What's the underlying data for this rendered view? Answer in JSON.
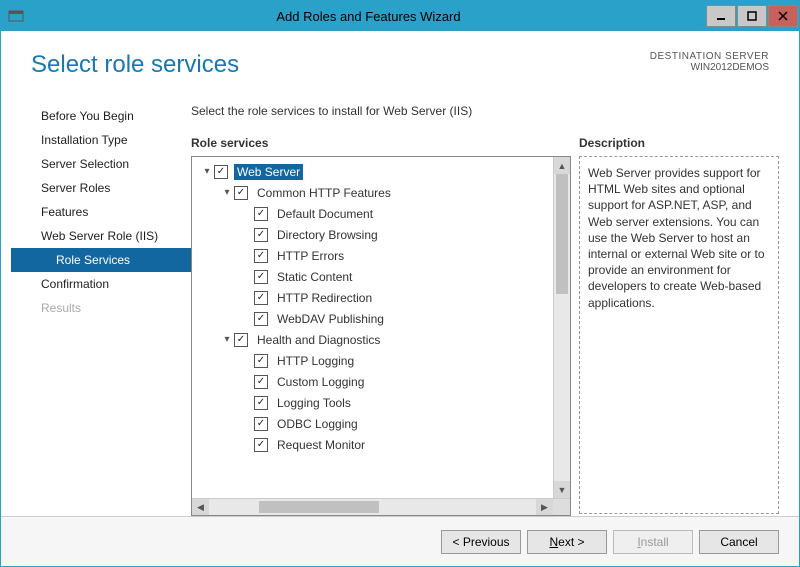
{
  "window": {
    "title": "Add Roles and Features Wizard"
  },
  "header": {
    "title": "Select role services",
    "dest_label": "DESTINATION SERVER",
    "dest_value": "WIN2012DEMOS"
  },
  "nav": {
    "items": [
      {
        "label": "Before You Begin"
      },
      {
        "label": "Installation Type"
      },
      {
        "label": "Server Selection"
      },
      {
        "label": "Server Roles"
      },
      {
        "label": "Features"
      },
      {
        "label": "Web Server Role (IIS)"
      },
      {
        "label": "Role Services",
        "child": true,
        "selected": true
      },
      {
        "label": "Confirmation"
      },
      {
        "label": "Results",
        "disabled": true
      }
    ]
  },
  "content": {
    "instruction": "Select the role services to install for Web Server (IIS)",
    "roles_label": "Role services",
    "desc_label": "Description",
    "desc_text": "Web Server provides support for HTML Web sites and optional support for ASP.NET, ASP, and Web server extensions. You can use the Web Server to host an internal or external Web site or to provide an environment for developers to create Web-based applications."
  },
  "tree": [
    {
      "indent": 0,
      "arrow": "▾",
      "checked": true,
      "label": "Web Server",
      "selected": true
    },
    {
      "indent": 1,
      "arrow": "▾",
      "checked": true,
      "label": "Common HTTP Features"
    },
    {
      "indent": 2,
      "arrow": "",
      "checked": true,
      "label": "Default Document"
    },
    {
      "indent": 2,
      "arrow": "",
      "checked": true,
      "label": "Directory Browsing"
    },
    {
      "indent": 2,
      "arrow": "",
      "checked": true,
      "label": "HTTP Errors"
    },
    {
      "indent": 2,
      "arrow": "",
      "checked": true,
      "label": "Static Content"
    },
    {
      "indent": 2,
      "arrow": "",
      "checked": true,
      "label": "HTTP Redirection"
    },
    {
      "indent": 2,
      "arrow": "",
      "checked": true,
      "label": "WebDAV Publishing"
    },
    {
      "indent": 1,
      "arrow": "▾",
      "checked": true,
      "label": "Health and Diagnostics"
    },
    {
      "indent": 2,
      "arrow": "",
      "checked": true,
      "label": "HTTP Logging"
    },
    {
      "indent": 2,
      "arrow": "",
      "checked": true,
      "label": "Custom Logging"
    },
    {
      "indent": 2,
      "arrow": "",
      "checked": true,
      "label": "Logging Tools"
    },
    {
      "indent": 2,
      "arrow": "",
      "checked": true,
      "label": "ODBC Logging"
    },
    {
      "indent": 2,
      "arrow": "",
      "checked": true,
      "label": "Request Monitor"
    }
  ],
  "footer": {
    "previous": "< Previous",
    "next_pre": "",
    "next_u": "N",
    "next_post": "ext >",
    "install_pre": "",
    "install_u": "I",
    "install_post": "nstall",
    "cancel": "Cancel"
  }
}
